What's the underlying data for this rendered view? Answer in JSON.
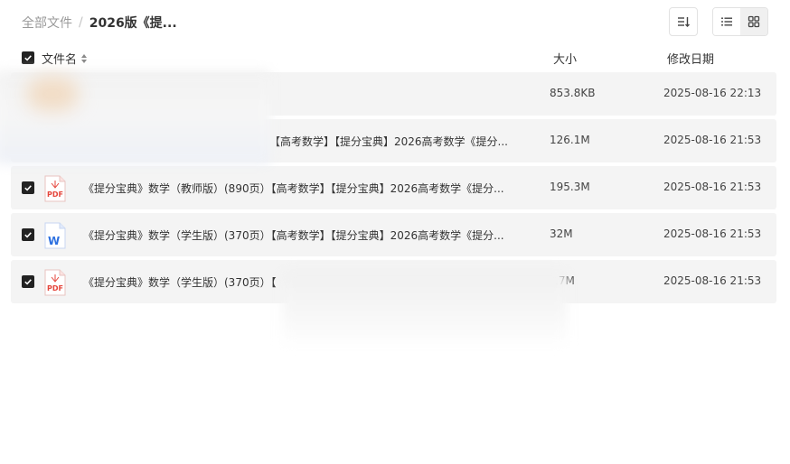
{
  "breadcrumb": {
    "root": "全部文件",
    "separator": "/",
    "current": "2026版《提..."
  },
  "toolbar": {
    "sort_icon": "sort-lines-icon",
    "list_view_icon": "list-view-icon",
    "grid_view_icon": "grid-view-icon"
  },
  "columns": {
    "name": "文件名",
    "size": "大小",
    "date": "修改日期"
  },
  "colors": {
    "row_background": "#f4f4f4",
    "checkbox": "#222222",
    "pdf_red": "#e5463c",
    "word_blue": "#2b6fe0"
  },
  "files": [
    {
      "icon": "image-file-icon",
      "name": "",
      "size": "853.8KB",
      "date": "2025-08-16 22:13",
      "checked": true
    },
    {
      "icon": "image-file-icon",
      "name": "【高考数学】【提分宝典】2026高考数学《提分...",
      "size": "126.1M",
      "date": "2025-08-16 21:53",
      "checked": true
    },
    {
      "icon": "pdf-file-icon",
      "name": "《提分宝典》数学（教师版）(890页）【高考数学】【提分宝典】2026高考数学《提分...",
      "size": "195.3M",
      "date": "2025-08-16 21:53",
      "checked": true
    },
    {
      "icon": "word-file-icon",
      "name": "《提分宝典》数学（学生版）(370页）【高考数学】【提分宝典】2026高考数学《提分...",
      "size": "32M",
      "date": "2025-08-16 21:53",
      "checked": true
    },
    {
      "icon": "pdf-file-icon",
      "name": "《提分宝典》数学（学生版）(370页）【",
      "size": ".7M",
      "date": "2025-08-16 21:53",
      "checked": true
    }
  ]
}
